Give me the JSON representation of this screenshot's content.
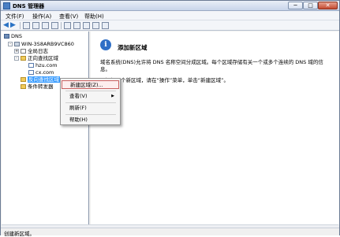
{
  "window": {
    "title": "DNS 管理器",
    "min_glyph": "─",
    "max_glyph": "□",
    "close_glyph": "✕"
  },
  "menubar": {
    "items": [
      {
        "label": "文件(F)"
      },
      {
        "label": "操作(A)"
      },
      {
        "label": "查看(V)"
      },
      {
        "label": "帮助(H)"
      }
    ]
  },
  "toolbar": {
    "back_glyph": "◀",
    "fwd_glyph": "▶"
  },
  "tree": {
    "root": "DNS",
    "server": "WIN-3S8ARB9VC860",
    "items": [
      {
        "label": "全局日志"
      },
      {
        "label": "正向查找区域"
      },
      {
        "label": "hzu.com"
      },
      {
        "label": "cx.com"
      },
      {
        "label": "反向查找区域"
      },
      {
        "label": "条件转发器"
      }
    ],
    "collapsed_glyph": "+",
    "expanded_glyph": "-"
  },
  "main": {
    "heading": "添加新区域",
    "info_glyph": "i",
    "description": "域名系统(DNS)允许将 DNS 名称空间分成区域。每个区域存储有关一个或多个连续的 DNS 域的信息。",
    "instruction": "要添加一个新区域，请在“操作”菜单，单击“新建区域”。"
  },
  "context_menu": {
    "items": [
      {
        "label": "新建区域(Z)..."
      },
      {
        "label": "查看(V)",
        "submenu_glyph": "▶"
      },
      {
        "label": "刷新(F)"
      },
      {
        "label": "帮助(H)"
      }
    ]
  },
  "status": {
    "text": "创建新区域。"
  },
  "colors": {
    "selection": "#3399ff",
    "menu_highlight_border": "#c96161",
    "info_icon": "#2f6fc6"
  }
}
